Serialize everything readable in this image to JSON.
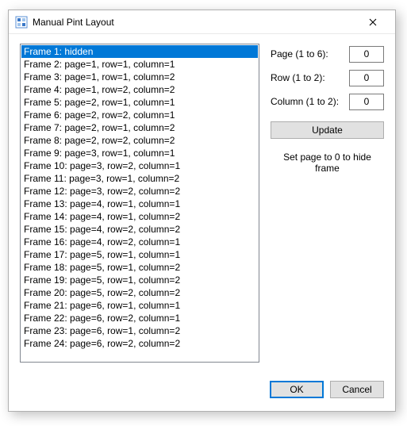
{
  "window": {
    "title": "Manual Pint Layout"
  },
  "list": {
    "selected_index": 0,
    "items": [
      "Frame 1: hidden",
      "Frame 2: page=1, row=1, column=1",
      "Frame 3: page=1, row=1, column=2",
      "Frame 4: page=1, row=2, column=2",
      "Frame 5: page=2, row=1, column=1",
      "Frame 6: page=2, row=2, column=1",
      "Frame 7: page=2, row=1, column=2",
      "Frame 8: page=2, row=2, column=2",
      "Frame 9: page=3, row=1, column=1",
      "Frame 10: page=3, row=2, column=1",
      "Frame 11: page=3, row=1, column=2",
      "Frame 12: page=3, row=2, column=2",
      "Frame 13: page=4, row=1, column=1",
      "Frame 14: page=4, row=1, column=2",
      "Frame 15: page=4, row=2, column=2",
      "Frame 16: page=4, row=2, column=1",
      "Frame 17: page=5, row=1, column=1",
      "Frame 18: page=5, row=1, column=2",
      "Frame 19: page=5, row=1, column=2",
      "Frame 20: page=5, row=2, column=2",
      "Frame 21: page=6, row=1, column=1",
      "Frame 22: page=6, row=2, column=1",
      "Frame 23: page=6, row=1, column=2",
      "Frame 24: page=6, row=2, column=2"
    ]
  },
  "fields": {
    "page": {
      "label": "Page (1 to 6):",
      "value": "0"
    },
    "row": {
      "label": "Row (1 to 2):",
      "value": "0"
    },
    "column": {
      "label": "Column (1 to 2):",
      "value": "0"
    }
  },
  "update_label": "Update",
  "hint": "Set page to 0 to hide frame",
  "footer": {
    "ok": "OK",
    "cancel": "Cancel"
  }
}
